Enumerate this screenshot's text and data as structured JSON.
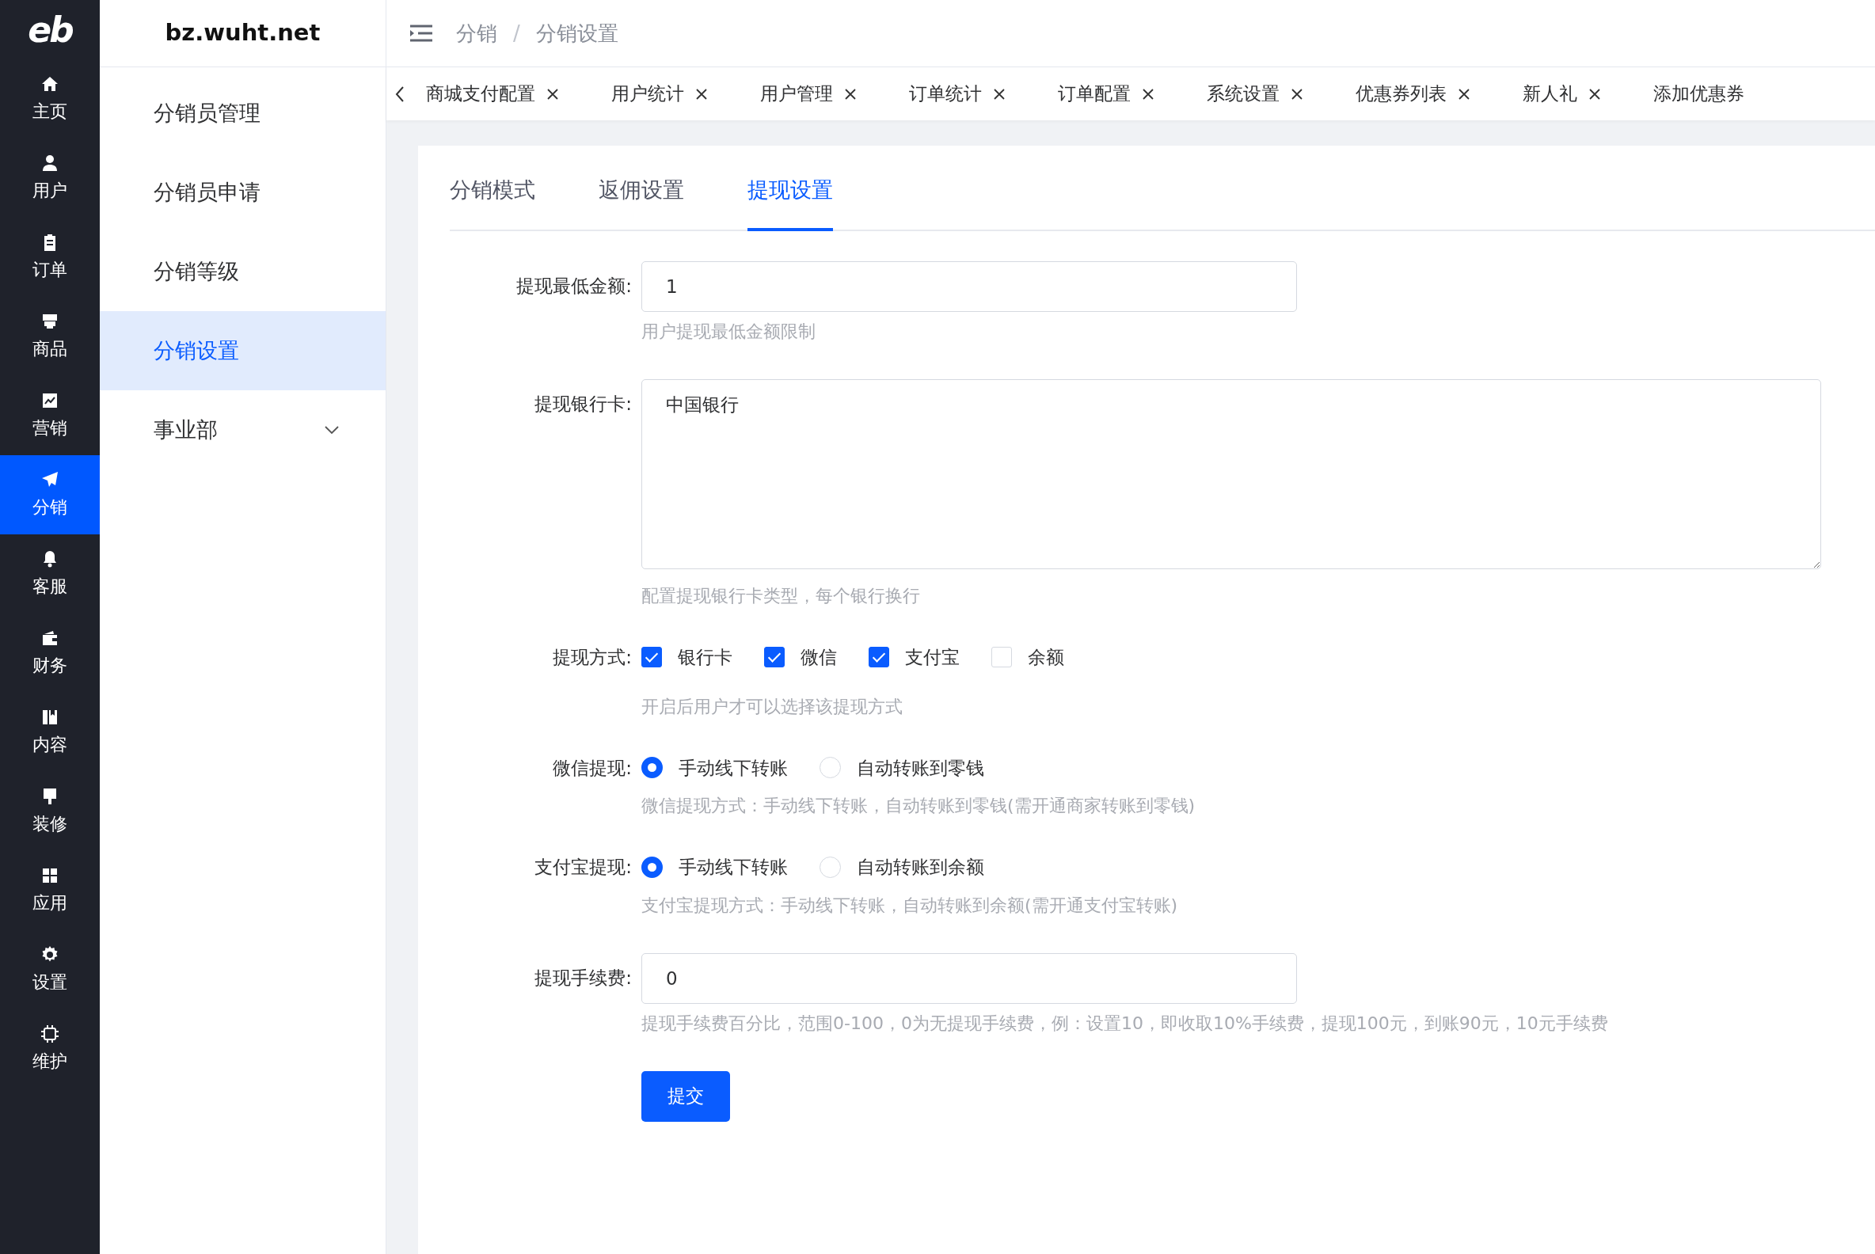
{
  "logo": "eb",
  "rail": [
    {
      "label": "主页",
      "selected": false
    },
    {
      "label": "用户",
      "selected": false
    },
    {
      "label": "订单",
      "selected": false
    },
    {
      "label": "商品",
      "selected": false
    },
    {
      "label": "营销",
      "selected": false
    },
    {
      "label": "分销",
      "selected": true
    },
    {
      "label": "客服",
      "selected": false
    },
    {
      "label": "财务",
      "selected": false
    },
    {
      "label": "内容",
      "selected": false
    },
    {
      "label": "装修",
      "selected": false
    },
    {
      "label": "应用",
      "selected": false
    },
    {
      "label": "设置",
      "selected": false
    },
    {
      "label": "维护",
      "selected": false
    }
  ],
  "site_title": "bz.wuht.net",
  "submenu": [
    {
      "label": "分销员管理",
      "selected": false
    },
    {
      "label": "分销员申请",
      "selected": false
    },
    {
      "label": "分销等级",
      "selected": false
    },
    {
      "label": "分销设置",
      "selected": true
    },
    {
      "label": "事业部",
      "selected": false,
      "expanded": false
    }
  ],
  "breadcrumb": [
    "分销",
    "分销设置"
  ],
  "breadcrumb_separator": "/",
  "open_tabs": [
    "商城支付配置",
    "用户统计",
    "用户管理",
    "订单统计",
    "订单配置",
    "系统设置",
    "优惠券列表",
    "新人礼",
    "添加优惠券"
  ],
  "content_tabs": [
    {
      "label": "分销模式",
      "selected": false
    },
    {
      "label": "返佣设置",
      "selected": false
    },
    {
      "label": "提现设置",
      "selected": true
    }
  ],
  "form": [
    {
      "kind": "input",
      "label": "提现最低金额:",
      "value": "1",
      "hint": "用户提现最低金额限制"
    },
    {
      "kind": "textarea",
      "label": "提现银行卡:",
      "value": "中国银行",
      "hint": "配置提现银行卡类型，每个银行换行"
    },
    {
      "kind": "checkbox",
      "label": "提现方式:",
      "options": [
        {
          "label": "银行卡",
          "checked": true
        },
        {
          "label": "微信",
          "checked": true
        },
        {
          "label": "支付宝",
          "checked": true
        },
        {
          "label": "余额",
          "checked": false
        }
      ],
      "hint": "开启后用户才可以选择该提现方式"
    },
    {
      "kind": "radio",
      "label": "微信提现:",
      "options": [
        {
          "label": "手动线下转账",
          "selected": true
        },
        {
          "label": "自动转账到零钱",
          "selected": false
        }
      ],
      "hint": "微信提现方式：手动线下转账，自动转账到零钱(需开通商家转账到零钱)"
    },
    {
      "kind": "radio",
      "label": "支付宝提现:",
      "options": [
        {
          "label": "手动线下转账",
          "selected": true
        },
        {
          "label": "自动转账到余额",
          "selected": false
        }
      ],
      "hint": "支付宝提现方式：手动线下转账，自动转账到余额(需开通支付宝转账)"
    },
    {
      "kind": "input",
      "label": "提现手续费:",
      "value": "0",
      "hint": "提现手续费百分比，范围0-100，0为无提现手续费，例：设置10，即收取10%手续费，提现100元，到账90元，10元手续费"
    }
  ],
  "submit": "提交"
}
